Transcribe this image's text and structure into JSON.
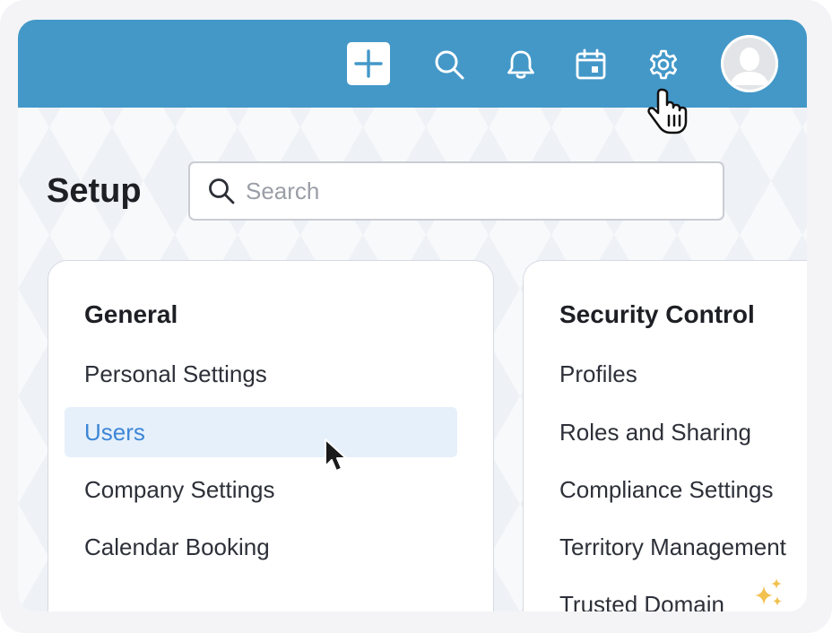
{
  "header": {
    "icons": [
      "plus-icon",
      "search-icon",
      "bell-icon",
      "calendar-icon",
      "gear-icon",
      "user-avatar"
    ],
    "accent_color": "#4398c8"
  },
  "page": {
    "title": "Setup"
  },
  "search": {
    "placeholder": "Search"
  },
  "general": {
    "heading": "General",
    "items": [
      {
        "label": "Personal Settings"
      },
      {
        "label": "Users"
      },
      {
        "label": "Company Settings"
      },
      {
        "label": "Calendar Booking"
      }
    ],
    "active_item": "Users",
    "active_color": "#3d86d6"
  },
  "security": {
    "heading": "Security Control",
    "items": [
      {
        "label": "Profiles"
      },
      {
        "label": "Roles and Sharing"
      },
      {
        "label": "Compliance Settings"
      },
      {
        "label": "Territory Management"
      },
      {
        "label": "Trusted Domain"
      }
    ],
    "sparkle_color": "#f2c14e"
  }
}
